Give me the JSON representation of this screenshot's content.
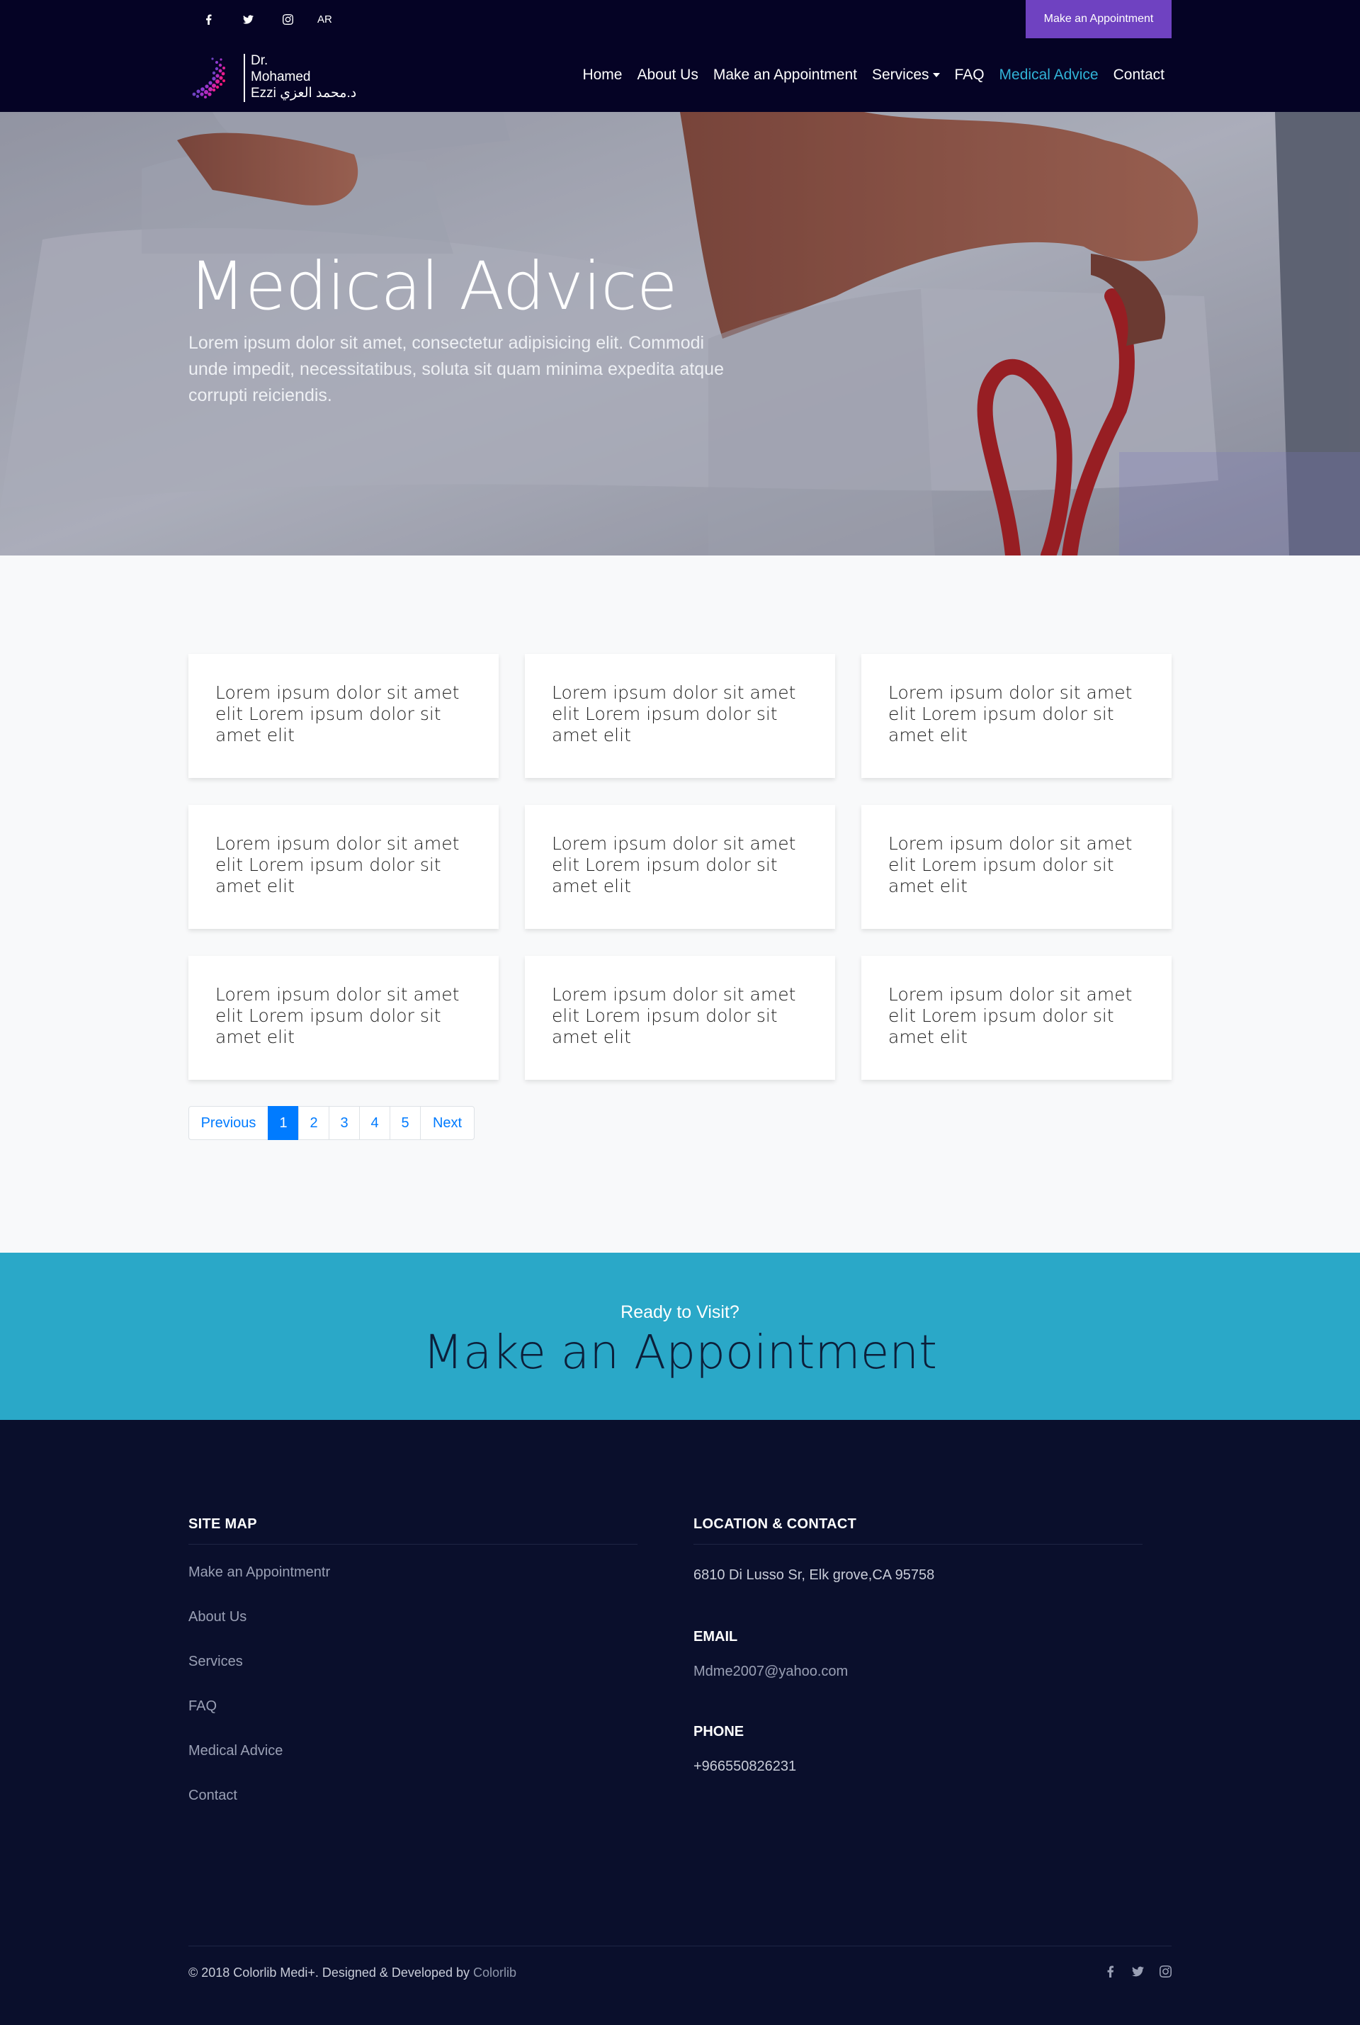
{
  "topbar": {
    "social": [
      "facebook-icon",
      "twitter-icon",
      "instagram-icon"
    ],
    "lang": "AR",
    "appointment_button": "Make an Appointment"
  },
  "logo": {
    "line1": "Dr.",
    "line2": "Mohamed",
    "line3": "Ezzi د.محمد العزي"
  },
  "nav": {
    "items": [
      {
        "label": "Home"
      },
      {
        "label": "About Us"
      },
      {
        "label": "Make an Appointment"
      },
      {
        "label": "Services"
      },
      {
        "label": "FAQ"
      },
      {
        "label": "Medical Advice"
      },
      {
        "label": "Contact"
      }
    ],
    "active": "Medical Advice"
  },
  "hero": {
    "title": "Medical Advice",
    "text": "Lorem ipsum dolor sit amet, consectetur adipisicing elit. Commodi unde impedit, necessitatibus, soluta sit quam minima expedita atque corrupti reiciendis."
  },
  "cards": [
    "Lorem ipsum dolor sit amet elit Lorem ipsum dolor sit amet elit",
    "Lorem ipsum dolor sit amet elit Lorem ipsum dolor sit amet elit",
    "Lorem ipsum dolor sit amet elit Lorem ipsum dolor sit amet elit",
    "Lorem ipsum dolor sit amet elit Lorem ipsum dolor sit amet elit",
    "Lorem ipsum dolor sit amet elit Lorem ipsum dolor sit amet elit",
    "Lorem ipsum dolor sit amet elit Lorem ipsum dolor sit amet elit",
    "Lorem ipsum dolor sit amet elit Lorem ipsum dolor sit amet elit",
    "Lorem ipsum dolor sit amet elit Lorem ipsum dolor sit amet elit",
    "Lorem ipsum dolor sit amet elit Lorem ipsum dolor sit amet elit"
  ],
  "pagination": {
    "previous": "Previous",
    "pages": [
      "1",
      "2",
      "3",
      "4",
      "5"
    ],
    "current": "1",
    "next": "Next"
  },
  "cta": {
    "small": "Ready to Visit?",
    "big": "Make an Appointment"
  },
  "footer": {
    "sitemap_title": "SITE MAP",
    "sitemap": [
      "Make an Appointmentr",
      "About Us",
      "Services",
      "FAQ",
      "Medical Advice",
      "Contact"
    ],
    "contact_title": "LOCATION & CONTACT",
    "address": "6810 Di Lusso Sr, Elk grove,CA 95758",
    "email_label": "EMAIL",
    "email": "Mdme2007@yahoo.com",
    "phone_label": "PHONE",
    "phone": "+966550826231",
    "copyright": "© 2018 Colorlib Medi+. Designed & Developed by",
    "copyright_link": "Colorlib",
    "social": [
      "facebook-icon",
      "twitter-icon",
      "instagram-icon"
    ]
  },
  "colors": {
    "header_bg": "#050325",
    "accent_purple": "#6f42c1",
    "nav_active": "#31b3d6",
    "cta_bg": "#2aa8c8",
    "footer_bg": "#0a0f2c",
    "link_blue": "#007bff"
  }
}
